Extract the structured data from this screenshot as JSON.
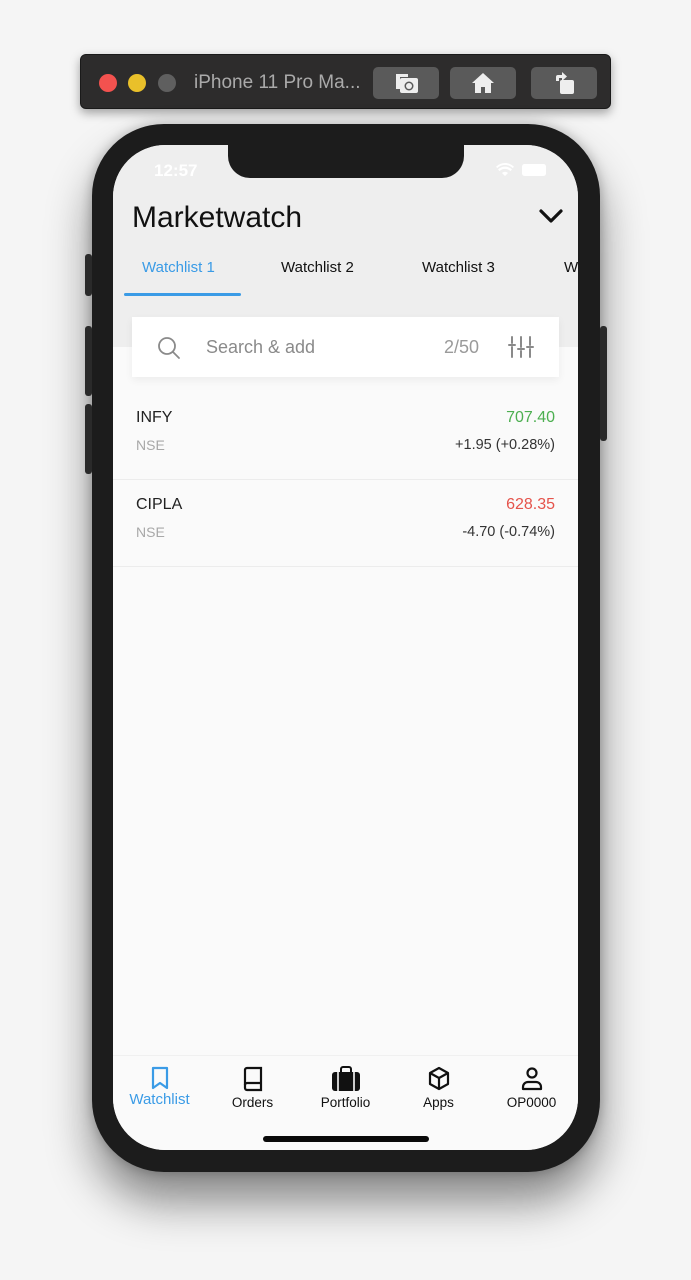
{
  "simulator": {
    "title": "iPhone 11 Pro Ma...",
    "buttons": [
      "screenshot",
      "home",
      "rotate"
    ]
  },
  "status_bar": {
    "time": "12:57"
  },
  "header": {
    "title": "Marketwatch"
  },
  "tabs": [
    {
      "label": "Watchlist 1",
      "active": true
    },
    {
      "label": "Watchlist 2",
      "active": false
    },
    {
      "label": "Watchlist 3",
      "active": false
    },
    {
      "label": "W",
      "active": false
    }
  ],
  "search": {
    "placeholder": "Search & add",
    "count": "2/50"
  },
  "colors": {
    "accent": "#3a9be6",
    "up": "#4caf50",
    "down": "#e5534b"
  },
  "watchlist": [
    {
      "symbol": "INFY",
      "exchange": "NSE",
      "ltp": "707.40",
      "change": "+1.95 (+0.28%)",
      "direction": "up"
    },
    {
      "symbol": "CIPLA",
      "exchange": "NSE",
      "ltp": "628.35",
      "change": "-4.70 (-0.74%)",
      "direction": "down"
    }
  ],
  "bottom_nav": [
    {
      "label": "Watchlist",
      "icon": "bookmark-icon",
      "active": true
    },
    {
      "label": "Orders",
      "icon": "book-icon",
      "active": false
    },
    {
      "label": "Portfolio",
      "icon": "briefcase-icon",
      "active": false
    },
    {
      "label": "Apps",
      "icon": "cube-icon",
      "active": false
    },
    {
      "label": "OP0000",
      "icon": "user-icon",
      "active": false
    }
  ]
}
